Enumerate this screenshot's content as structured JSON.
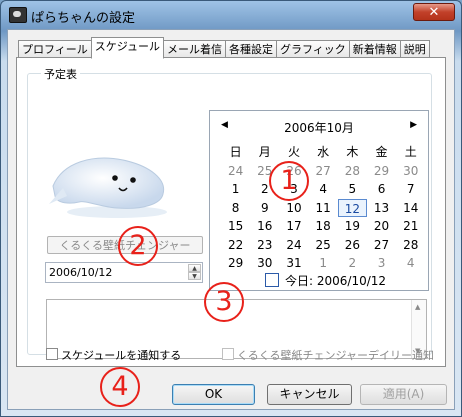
{
  "window": {
    "title": "ぱらちゃんの設定",
    "close_label": "✕"
  },
  "tabs": [
    "プロフィール",
    "スケジュール",
    "メール着信",
    "各種設定",
    "グラフィック",
    "新着情報",
    "説明"
  ],
  "active_tab_index": 1,
  "schedule": {
    "group_label": "予定表",
    "wallpaper_button": "くるくる壁紙チェンジャー",
    "date_value": "2006/10/12",
    "calendar": {
      "title": "2006年10月",
      "weekdays": [
        "日",
        "月",
        "火",
        "水",
        "木",
        "金",
        "土"
      ],
      "weeks": [
        [
          "24",
          "25",
          "26",
          "27",
          "28",
          "29",
          "30"
        ],
        [
          "1",
          "2",
          "3",
          "4",
          "5",
          "6",
          "7"
        ],
        [
          "8",
          "9",
          "10",
          "11",
          "12",
          "13",
          "14"
        ],
        [
          "15",
          "16",
          "17",
          "18",
          "19",
          "20",
          "21"
        ],
        [
          "22",
          "23",
          "24",
          "25",
          "26",
          "27",
          "28"
        ],
        [
          "29",
          "30",
          "31",
          "1",
          "2",
          "3",
          "4"
        ]
      ],
      "selected_day": "12",
      "today_label": "今日: 2006/10/12"
    },
    "notify_checkbox": "スケジュールを通知する",
    "daily_checkbox": "くるくる壁紙チェンジャーデイリー通知"
  },
  "buttons": {
    "ok": "OK",
    "cancel": "キャンセル",
    "apply": "適用(A)"
  },
  "annotations": [
    "1",
    "2",
    "3",
    "4"
  ]
}
